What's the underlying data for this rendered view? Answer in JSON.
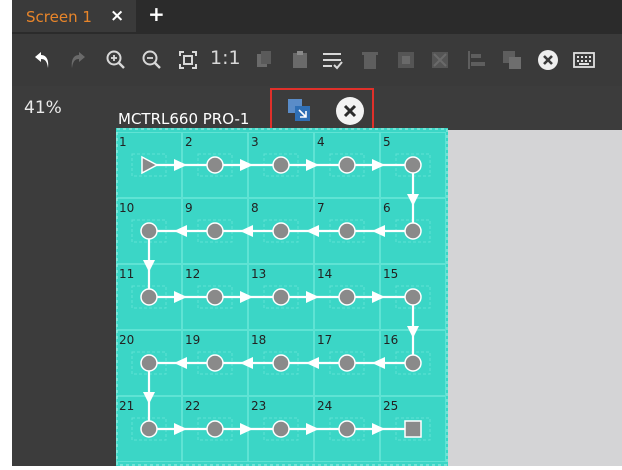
{
  "tabs": [
    {
      "label": "Screen 1",
      "close_glyph": "×",
      "active": true,
      "color": "#e8852a"
    }
  ],
  "add_tab_glyph": "+",
  "toolbar": {
    "icons": [
      "undo-icon",
      "redo-icon",
      "zoom-in-icon",
      "zoom-out-icon",
      "fit-screen-icon",
      "actual-size-icon",
      "copy-icon",
      "paste-icon",
      "auto-connect-icon",
      "delete-icon",
      "select-icon",
      "deselect-icon",
      "align-icon",
      "cascade-icon",
      "close-circle-icon",
      "keyboard-icon"
    ],
    "actual_size_label": "1:1"
  },
  "canvas": {
    "zoom_percent": "41%",
    "cabinet_title": "MCTRL660 PRO-1",
    "highlight_color": "#e0302a",
    "grid_color": "#3bd6c6",
    "cabinets": {
      "rows": 5,
      "cols": 5,
      "labels": [
        [
          "1",
          "2",
          "3",
          "4",
          "5"
        ],
        [
          "10",
          "9",
          "8",
          "7",
          "6"
        ],
        [
          "11",
          "12",
          "13",
          "14",
          "15"
        ],
        [
          "20",
          "19",
          "18",
          "17",
          "16"
        ],
        [
          "21",
          "22",
          "23",
          "24",
          "25"
        ]
      ],
      "row_direction": [
        "right",
        "left",
        "right",
        "left",
        "right"
      ]
    }
  }
}
